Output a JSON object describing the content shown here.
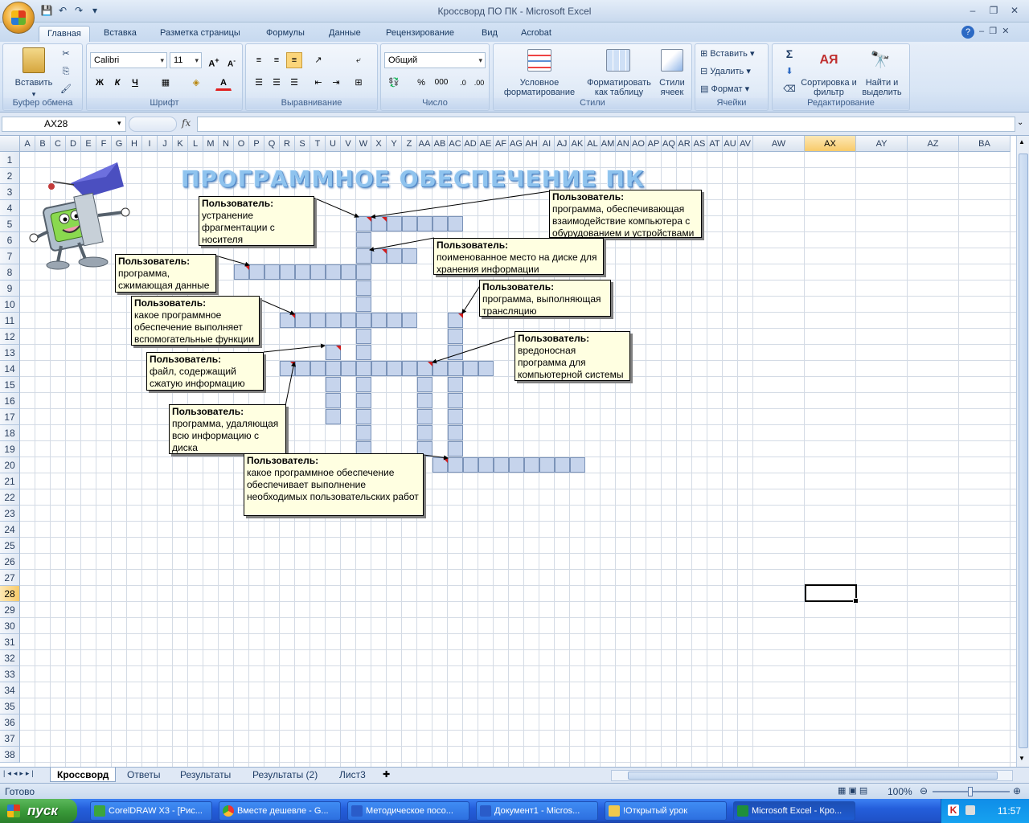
{
  "window": {
    "title": "Кроссворд ПО ПК - Microsoft Excel"
  },
  "ribbon_tabs": [
    "Главная",
    "Вставка",
    "Разметка страницы",
    "Формулы",
    "Данные",
    "Рецензирование",
    "Вид",
    "Acrobat"
  ],
  "ribbon": {
    "clipboard": {
      "paste": "Вставить",
      "label": "Буфер обмена"
    },
    "font": {
      "name": "Calibri",
      "size": "11",
      "bold": "Ж",
      "italic": "К",
      "underline": "Ч",
      "label": "Шрифт"
    },
    "alignment": {
      "label": "Выравнивание"
    },
    "number": {
      "format": "Общий",
      "percent": "%",
      "thousands": "000",
      "label": "Число"
    },
    "styles": {
      "conditional": "Условное форматирование",
      "as_table": "Форматировать как таблицу",
      "cell_styles": "Стили ячеек",
      "label": "Стили"
    },
    "cells": {
      "insert": "Вставить",
      "delete": "Удалить",
      "format": "Формат",
      "label": "Ячейки"
    },
    "editing": {
      "sum": "Σ",
      "sort": "Сортировка и фильтр",
      "find": "Найти и выделить",
      "label": "Редактирование"
    }
  },
  "formula_bar": {
    "name_box": "AX28",
    "fx": "fx",
    "value": ""
  },
  "columns": [
    "A",
    "B",
    "C",
    "D",
    "E",
    "F",
    "G",
    "H",
    "I",
    "J",
    "K",
    "L",
    "M",
    "N",
    "O",
    "P",
    "Q",
    "R",
    "S",
    "T",
    "U",
    "V",
    "W",
    "X",
    "Y",
    "Z",
    "AA",
    "AB",
    "AC",
    "AD",
    "AE",
    "AF",
    "AG",
    "AH",
    "AI",
    "AJ",
    "AK",
    "AL",
    "AM",
    "AN",
    "AO",
    "AP",
    "AQ",
    "AR",
    "AS",
    "AT",
    "AU",
    "AV",
    "AW",
    "AX",
    "AY",
    "AZ",
    "BA"
  ],
  "rows": [
    "1",
    "2",
    "3",
    "4",
    "5",
    "6",
    "7",
    "8",
    "9",
    "10",
    "11",
    "12",
    "13",
    "14",
    "15",
    "16",
    "17",
    "18",
    "19",
    "20",
    "21",
    "22",
    "23",
    "24",
    "25",
    "26",
    "27",
    "28",
    "29",
    "30",
    "31",
    "32",
    "33",
    "34",
    "35",
    "36",
    "37",
    "38"
  ],
  "selected_cell": {
    "column": "AX",
    "row": "28"
  },
  "sheet_title": "ПРОГРАММНОЕ ОБЕСПЕЧЕНИЕ ПК",
  "comments": [
    {
      "author": "Пользователь:",
      "text": "устранение фрагментации с носителя"
    },
    {
      "author": "Пользователь:",
      "text": "программа, обеспечивающая взаимодействие компьютера с обурудованием и устройствами"
    },
    {
      "author": "Пользователь:",
      "text": "поименованное место на диске для хранения информации"
    },
    {
      "author": "Пользователь:",
      "text": "программа, сжимающая данные"
    },
    {
      "author": "Пользователь:",
      "text": "программа, выполняющая трансляцию"
    },
    {
      "author": "Пользователь:",
      "text": "какое программное обеспечение выполняет вспомогательные функции"
    },
    {
      "author": "Пользователь:",
      "text": "вредоносная программа для компьютерной системы"
    },
    {
      "author": "Пользователь:",
      "text": "файл, содержащий сжатую информацию"
    },
    {
      "author": "Пользователь:",
      "text": "программа, удаляющая всю информацию с диска"
    },
    {
      "author": "Пользователь:",
      "text": "какое программное обеспечение обеспечивает выполнение необходимых пользовательских работ"
    }
  ],
  "sheet_tabs": [
    "Кроссворд",
    "Ответы",
    "Результаты",
    "Результаты (2)",
    "Лист3"
  ],
  "active_sheet": "Кроссворд",
  "status": {
    "ready": "Готово",
    "zoom": "100%"
  },
  "taskbar": {
    "start": "пуск",
    "items": [
      "CorelDRAW X3 - [Рис...",
      "Вместе дешевле - G...",
      "Методическое посо...",
      "Документ1 - Micros...",
      "!Открытый урок",
      "Microsoft Excel - Кро..."
    ],
    "lang": "RU",
    "time": "11:57"
  },
  "colors": {
    "crossword_cell": "#c6d4ec",
    "comment_bg": "#ffffe1",
    "selected_header": "#f8cb6a"
  }
}
